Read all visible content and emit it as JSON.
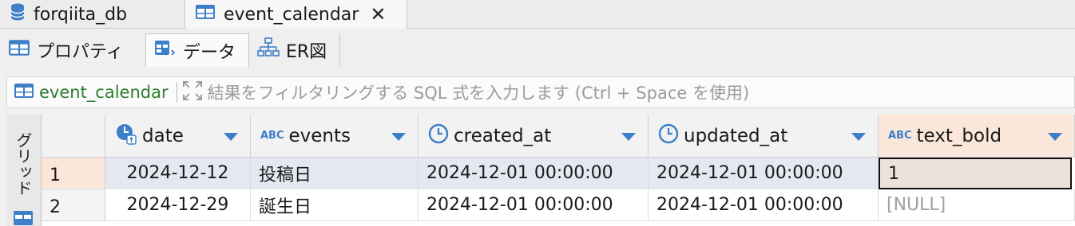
{
  "editor_tabs": [
    {
      "label": "forqiita_db",
      "icon": "database-icon"
    },
    {
      "label": "event_calendar",
      "icon": "table-icon",
      "active": true
    }
  ],
  "sub_tabs": [
    {
      "label": "プロパティ",
      "icon": "table-icon"
    },
    {
      "label": "データ",
      "icon": "data-editor-icon",
      "active": true
    },
    {
      "label": "ER図",
      "icon": "er-diagram-icon"
    }
  ],
  "filter": {
    "table_name": "event_calendar",
    "hint": "結果をフィルタリングする SQL 式を入力します (Ctrl + Space を使用)"
  },
  "grid": {
    "side_label": "グリッド",
    "columns": [
      {
        "name": "date",
        "type_icon": "date-key-icon"
      },
      {
        "name": "events",
        "type_icon": "abc-icon"
      },
      {
        "name": "created_at",
        "type_icon": "clock-icon"
      },
      {
        "name": "updated_at",
        "type_icon": "clock-icon"
      },
      {
        "name": "text_bold",
        "type_icon": "abc-icon"
      }
    ],
    "abc_label": "ABC",
    "rows": [
      {
        "num": "1",
        "date": "2024-12-12",
        "events": "投稿日",
        "created_at": "2024-12-01 00:00:00",
        "updated_at": "2024-12-01 00:00:00",
        "text_bold": "1"
      },
      {
        "num": "2",
        "date": "2024-12-29",
        "events": "誕生日",
        "created_at": "2024-12-01 00:00:00",
        "updated_at": "2024-12-01 00:00:00",
        "text_bold": "[NULL]"
      }
    ]
  },
  "colors": {
    "accent_blue": "#3d7ec9",
    "table_green": "#2d7d2d",
    "selected_header": "#fbe7da"
  }
}
